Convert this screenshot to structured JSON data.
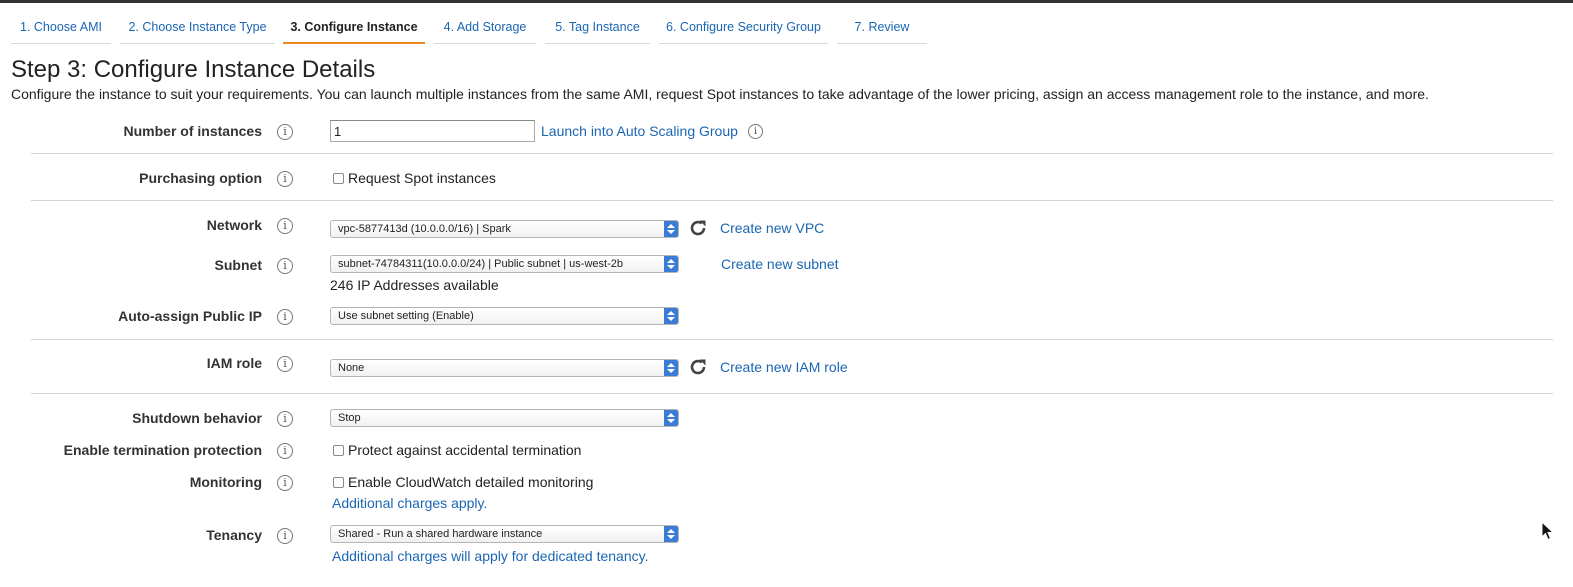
{
  "tabs": [
    {
      "label": "1. Choose AMI"
    },
    {
      "label": "2. Choose Instance Type"
    },
    {
      "label": "3. Configure Instance",
      "active": true
    },
    {
      "label": "4. Add Storage"
    },
    {
      "label": "5. Tag Instance"
    },
    {
      "label": "6. Configure Security Group"
    },
    {
      "label": "7. Review"
    }
  ],
  "page": {
    "title": "Step 3: Configure Instance Details",
    "description": "Configure the instance to suit your requirements. You can launch multiple instances from the same AMI, request Spot instances to take advantage of the lower pricing, assign an access management role to the instance, and more."
  },
  "form": {
    "num_instances": {
      "label": "Number of instances",
      "value": "1",
      "link": "Launch into Auto Scaling Group"
    },
    "purchasing": {
      "label": "Purchasing option",
      "checkbox_label": "Request Spot instances",
      "checked": false
    },
    "network": {
      "label": "Network",
      "value": "vpc-5877413d (10.0.0.0/16) | Spark",
      "link": "Create new VPC"
    },
    "subnet": {
      "label": "Subnet",
      "value": "subnet-74784311(10.0.0.0/24) | Public subnet | us-west-2b",
      "link": "Create new subnet",
      "note": "246 IP Addresses available"
    },
    "public_ip": {
      "label": "Auto-assign Public IP",
      "value": "Use subnet setting (Enable)"
    },
    "iam": {
      "label": "IAM role",
      "value": "None",
      "link": "Create new IAM role"
    },
    "shutdown": {
      "label": "Shutdown behavior",
      "value": "Stop"
    },
    "termination": {
      "label": "Enable termination protection",
      "checkbox_label": "Protect against accidental termination",
      "checked": false
    },
    "monitoring": {
      "label": "Monitoring",
      "checkbox_label": "Enable CloudWatch detailed monitoring",
      "checked": false,
      "note": "Additional charges apply."
    },
    "tenancy": {
      "label": "Tenancy",
      "value": "Shared - Run a shared hardware instance",
      "note": "Additional charges will apply for dedicated tenancy."
    }
  },
  "icons": {
    "info": "i"
  },
  "colors": {
    "link": "#1b66b3",
    "active_tab_underline": "#ec8a1f",
    "select_arrow": "#3a7bd5"
  }
}
